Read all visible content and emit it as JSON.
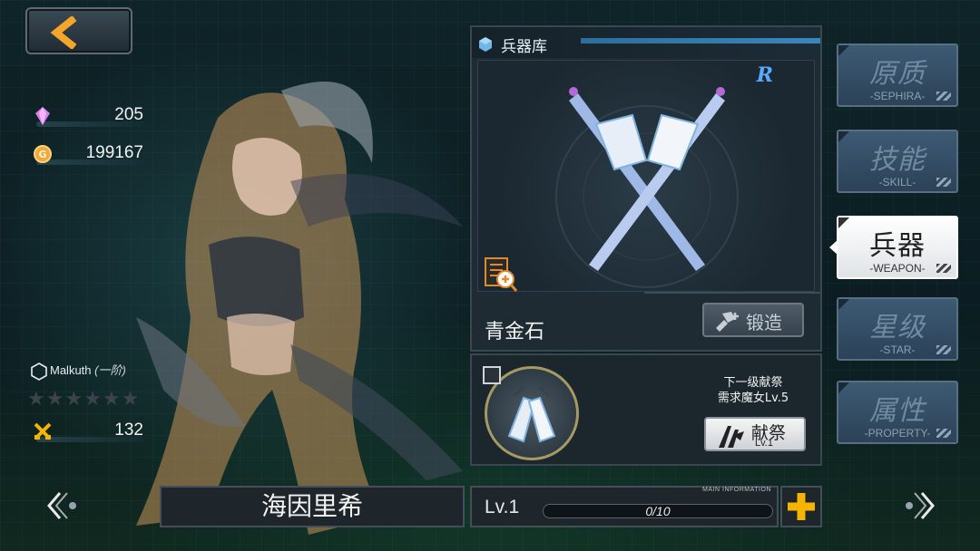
{
  "currency": {
    "crystals": "205",
    "gold": "199167"
  },
  "character": {
    "rank_name": "Malkuth",
    "rank_tier": "(一阶)",
    "stars_total": 6,
    "stars_filled": 0,
    "power_value": "132",
    "name": "海因里希",
    "level": "Lv.1",
    "exp_text": "0/10",
    "exp_fraction": 0.0
  },
  "panel": {
    "title": "兵器库",
    "weapon_name": "青金石",
    "rarity": "R",
    "forge_label": "锻造"
  },
  "sacrifice": {
    "requirement_line1": "下一级献祭",
    "requirement_line2": "需求魔女Lv.5",
    "button_label": "献祭",
    "button_level": "Lv.1"
  },
  "level_bar": {
    "info_caption": "MAIN INFORMATION"
  },
  "tabs": [
    {
      "label": "原质",
      "sub": "-SEPHIRA-",
      "active": false
    },
    {
      "label": "技能",
      "sub": "-SKILL-",
      "active": false
    },
    {
      "label": "兵器",
      "sub": "-WEAPON-",
      "active": true
    },
    {
      "label": "星级",
      "sub": "-STAR-",
      "active": false
    },
    {
      "label": "属性",
      "sub": "-PROPERTY-",
      "active": false
    }
  ],
  "colors": {
    "accent_blue": "#3a86bb",
    "rarity_blue": "#5aa8ff",
    "gold_accent": "#f4b400",
    "active_tab": "#ffffff"
  }
}
